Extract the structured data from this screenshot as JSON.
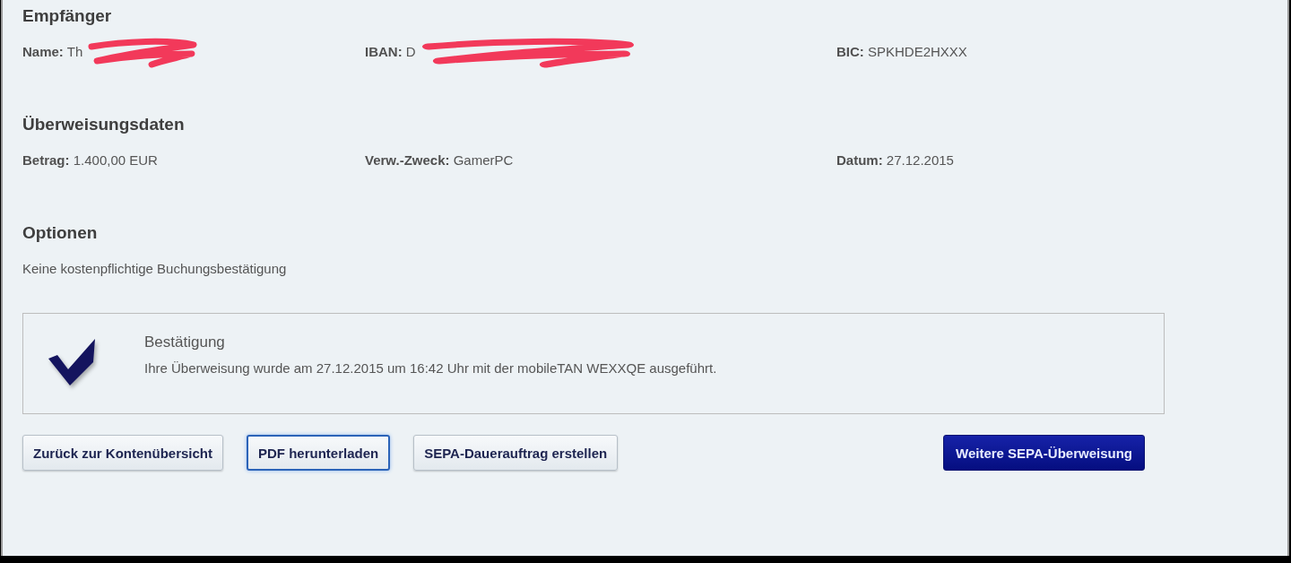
{
  "sections": [
    {
      "heading": "Empfänger",
      "fields": [
        {
          "label": "Name:",
          "value": "Th",
          "redacted": true
        },
        {
          "label": "IBAN:",
          "value": "D",
          "redacted": true
        },
        {
          "label": "BIC:",
          "value": "SPKHDE2HXXX"
        }
      ]
    },
    {
      "heading": "Überweisungsdaten",
      "fields": [
        {
          "label": "Betrag:",
          "value": "1.400,00 EUR"
        },
        {
          "label": "Verw.-Zweck:",
          "value": "GamerPC"
        },
        {
          "label": "Datum:",
          "value": "27.12.2015"
        }
      ]
    },
    {
      "heading": "Optionen",
      "text": "Keine kostenpflichtige Buchungsbestätigung"
    }
  ],
  "confirmation": {
    "title": "Bestätigung",
    "message": "Ihre Überweisung wurde am 27.12.2015 um 16:42 Uhr mit der mobileTAN WEXXQE ausgeführt."
  },
  "buttons": [
    {
      "label": "Zurück zur Kontenübersicht",
      "kind": "secondary",
      "focused": false
    },
    {
      "label": "PDF herunterladen",
      "kind": "secondary",
      "focused": true
    },
    {
      "label": "SEPA-Dauerauftrag erstellen",
      "kind": "secondary",
      "focused": false
    },
    {
      "label": "Weitere SEPA-Überweisung",
      "kind": "primary",
      "focused": false
    }
  ]
}
